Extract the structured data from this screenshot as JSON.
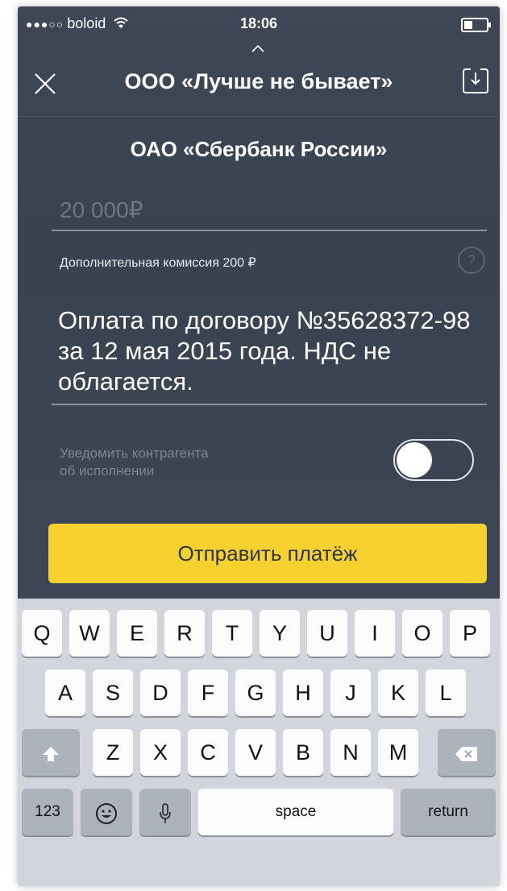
{
  "status_bar": {
    "signal": "●●●○○",
    "carrier": "boloid",
    "wifi_icon": "wifi-icon",
    "time": "18:06"
  },
  "header": {
    "title": "ООО «Лучше не бывает»",
    "close_icon": "close-icon",
    "export_icon": "export-icon"
  },
  "recipient_bank": "ОАО «Сбербанк России»",
  "amount": {
    "value": "20 000₽"
  },
  "commission": {
    "text": "Дополнительная комиссия 200 ₽",
    "help": "?"
  },
  "purpose": {
    "text": "Оплата по договору №35628372-98 за 12 мая 2015 года. НДС не облагается."
  },
  "notify": {
    "line1": "Уведомить контрагента",
    "line2": "об исполнении",
    "enabled": false
  },
  "send_button": {
    "label": "Отправить платёж"
  },
  "keyboard": {
    "row1": [
      "Q",
      "W",
      "E",
      "R",
      "T",
      "Y",
      "U",
      "I",
      "O",
      "P"
    ],
    "row2": [
      "A",
      "S",
      "D",
      "F",
      "G",
      "H",
      "J",
      "K",
      "L"
    ],
    "row3": [
      "Z",
      "X",
      "C",
      "V",
      "B",
      "N",
      "M"
    ],
    "numbers": "123",
    "space": "space",
    "return": "return"
  },
  "colors": {
    "background": "#3c4553",
    "accent": "#f6d231",
    "keyboard": "#d2d5db"
  }
}
